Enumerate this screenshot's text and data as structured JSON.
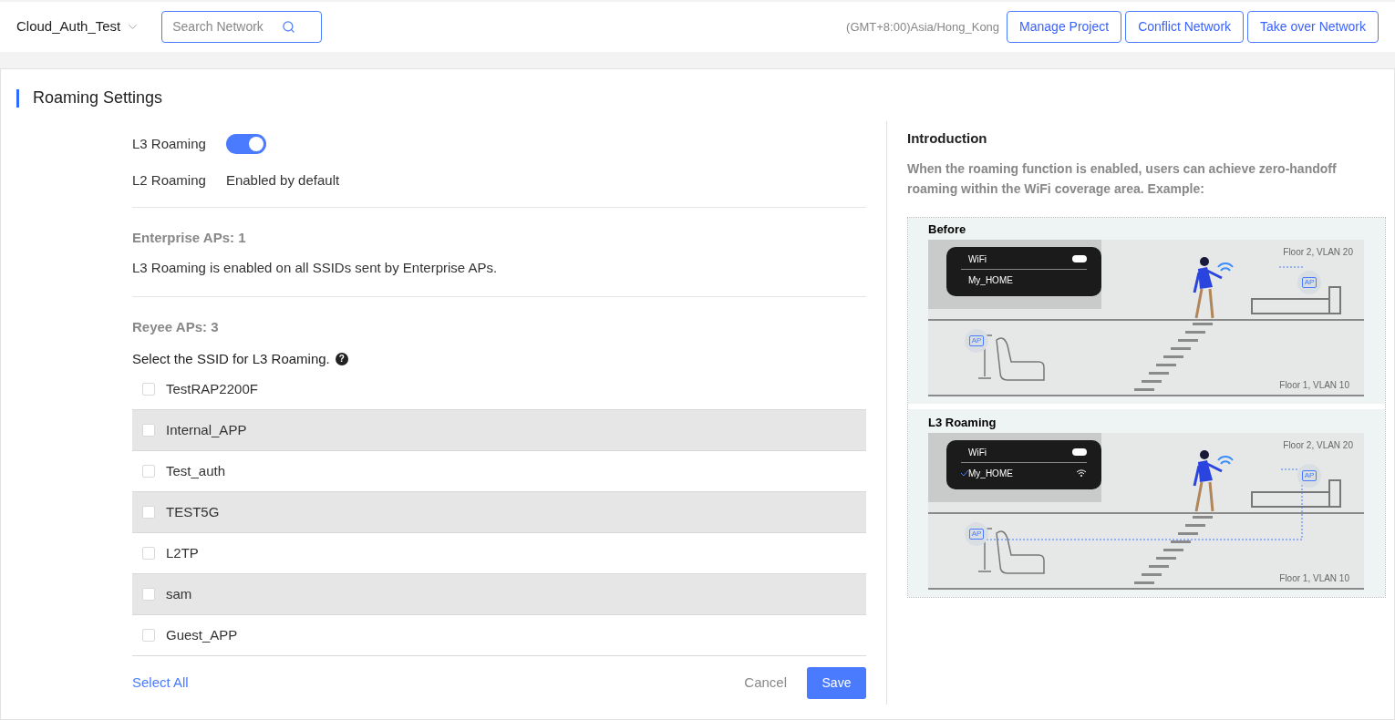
{
  "header": {
    "project": "Cloud_Auth_Test",
    "search": {
      "placeholder": "Search Network"
    },
    "timezone": "(GMT+8:00)Asia/Hong_Kong",
    "buttons": [
      "Manage Project",
      "Conflict Network",
      "Take over Network"
    ]
  },
  "section_title": "Roaming Settings",
  "l3_roaming": {
    "label": "L3 Roaming",
    "on": true
  },
  "l2_roaming": {
    "label": "L2 Roaming",
    "value": "Enabled by default"
  },
  "enterprise": {
    "title": "Enterprise APs: 1",
    "note": "L3 Roaming is enabled on all SSIDs sent by Enterprise APs."
  },
  "reyee": {
    "title": "Reyee APs: 3",
    "prompt": "Select the SSID for L3 Roaming.",
    "help_icon": "?"
  },
  "ssids": [
    {
      "name": "TestRAP2200F",
      "checked": false
    },
    {
      "name": "Internal_APP",
      "checked": false
    },
    {
      "name": "Test_auth",
      "checked": false
    },
    {
      "name": "TEST5G",
      "checked": false
    },
    {
      "name": "L2TP",
      "checked": false
    },
    {
      "name": "sam",
      "checked": false
    },
    {
      "name": "Guest_APP",
      "checked": false
    }
  ],
  "footer": {
    "select_all": "Select All",
    "cancel": "Cancel",
    "save": "Save"
  },
  "introduction": {
    "title": "Introduction",
    "text": "When the roaming function is enabled, users can achieve zero-handoff roaming within the WiFi coverage area. Example:",
    "panels": [
      {
        "title": "Before",
        "wifi": "WiFi",
        "network": "My_HOME",
        "connected": false,
        "floor_top": "Floor 2, VLAN 20",
        "floor_bottom": "Floor 1, VLAN 10",
        "ap_top": "AP",
        "ap_bottom": "AP"
      },
      {
        "title": "L3 Roaming",
        "wifi": "WiFi",
        "network": "My_HOME",
        "connected": true,
        "floor_top": "Floor 2, VLAN 20",
        "floor_bottom": "Floor 1, VLAN 10",
        "ap_top": "AP",
        "ap_bottom": "AP"
      }
    ]
  }
}
